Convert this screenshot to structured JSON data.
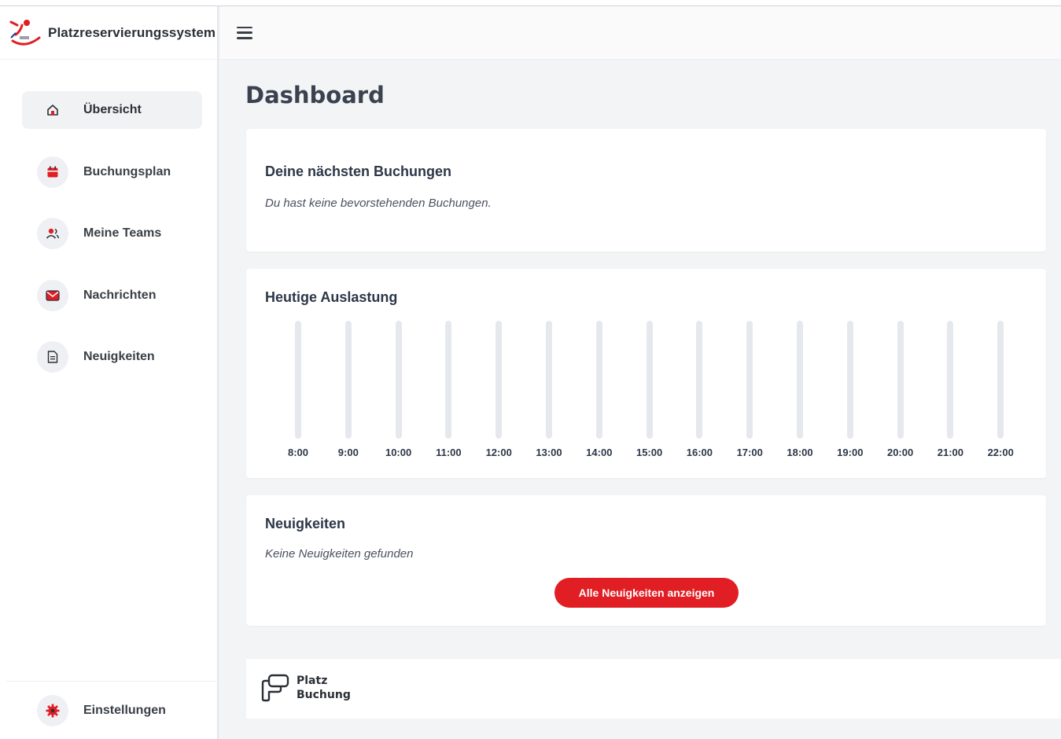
{
  "app": {
    "title": "Platzreservierungssystem"
  },
  "sidebar": {
    "items": [
      {
        "label": "Übersicht",
        "icon": "home-icon",
        "active": true
      },
      {
        "label": "Buchungsplan",
        "icon": "calendar-icon",
        "active": false
      },
      {
        "label": "Meine Teams",
        "icon": "users-icon",
        "active": false
      },
      {
        "label": "Nachrichten",
        "icon": "mail-icon",
        "active": false
      },
      {
        "label": "Neuigkeiten",
        "icon": "document-icon",
        "active": false
      }
    ],
    "settings": {
      "label": "Einstellungen",
      "icon": "gear-icon"
    }
  },
  "header": {
    "menu_icon": "hamburger-icon"
  },
  "main": {
    "title": "Dashboard",
    "bookings": {
      "title": "Deine nächsten Buchungen",
      "empty_text": "Du hast keine bevorstehenden Buchungen."
    },
    "utilization": {
      "title": "Heutige Auslastung"
    },
    "news": {
      "title": "Neuigkeiten",
      "empty_text": "Keine Neuigkeiten gefunden",
      "button_label": "Alle Neuigkeiten anzeigen"
    }
  },
  "footer": {
    "brand_line1": "Platz",
    "brand_line2": "Buchung"
  },
  "colors": {
    "accent": "#e01e24",
    "bar_track": "#e5e8ed",
    "text": "#2d3748"
  },
  "chart_data": {
    "type": "bar",
    "title": "Heutige Auslastung",
    "categories": [
      "8:00",
      "9:00",
      "10:00",
      "11:00",
      "12:00",
      "13:00",
      "14:00",
      "15:00",
      "16:00",
      "17:00",
      "18:00",
      "19:00",
      "20:00",
      "21:00",
      "22:00"
    ],
    "values": [
      0,
      0,
      0,
      0,
      0,
      0,
      0,
      0,
      0,
      0,
      0,
      0,
      0,
      0,
      0
    ],
    "ylim": [
      0,
      100
    ],
    "grid": false
  }
}
